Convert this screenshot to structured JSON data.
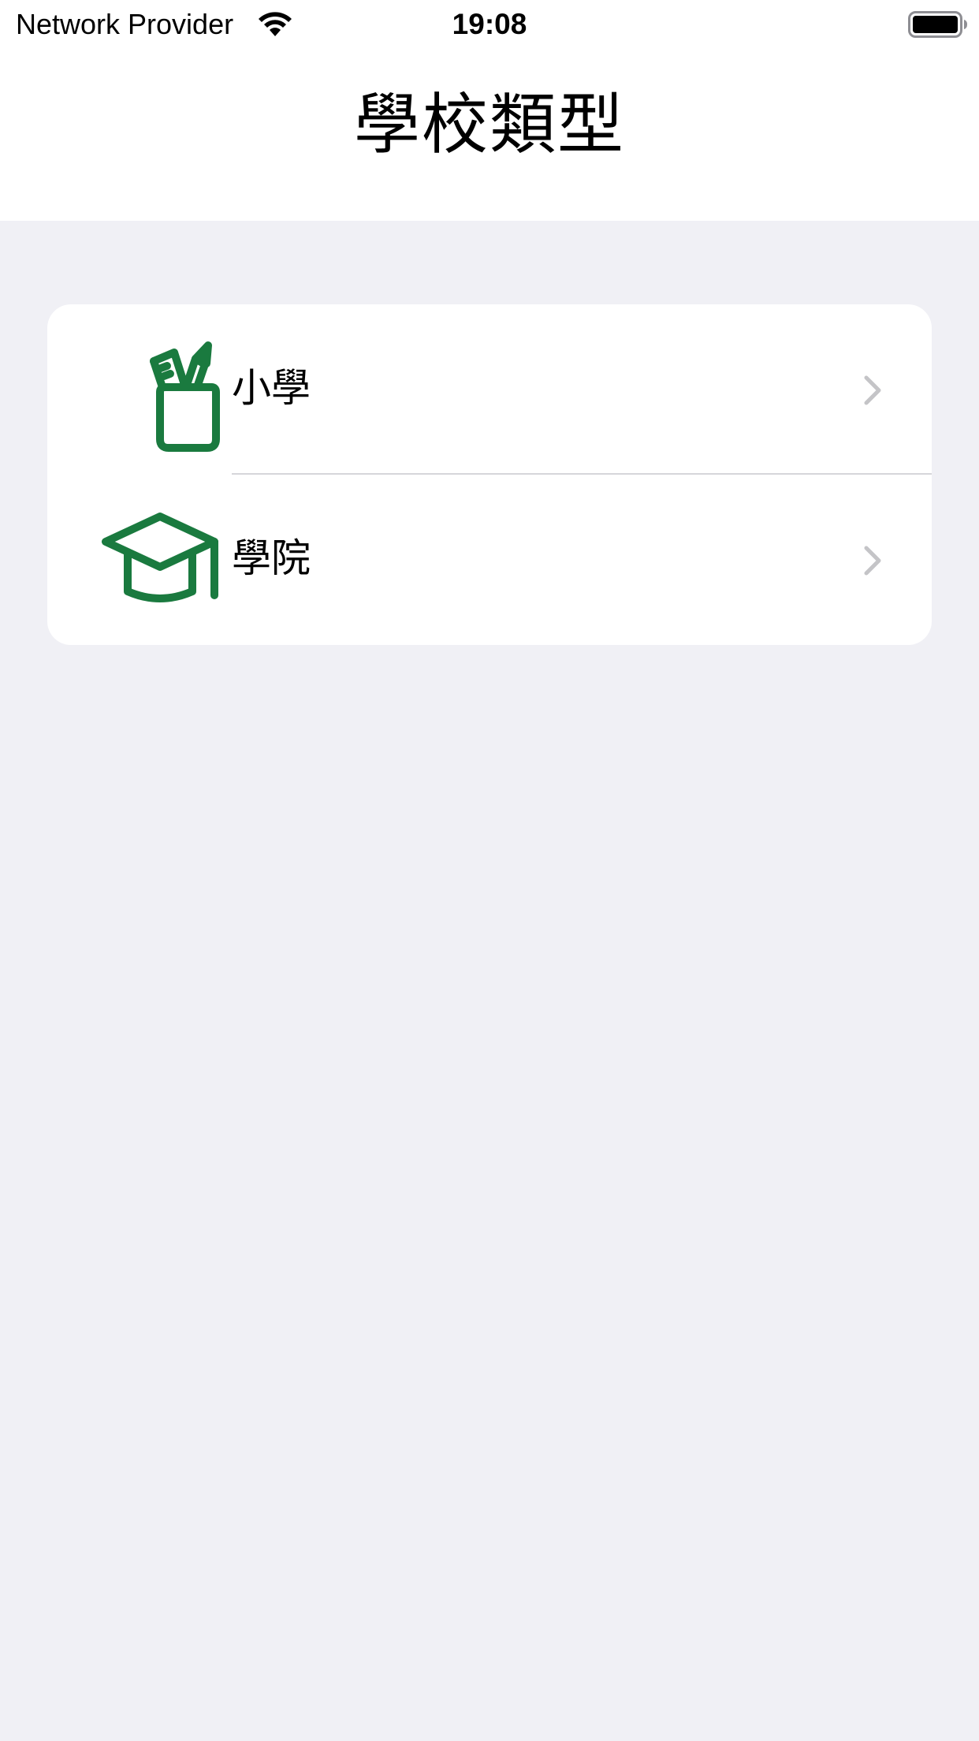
{
  "status_bar": {
    "carrier": "Network Provider",
    "time": "19:08",
    "wifi_icon": "wifi-icon",
    "battery_icon": "battery-full-icon"
  },
  "nav": {
    "title": "學校類型"
  },
  "list": {
    "items": [
      {
        "label": "小學",
        "icon": "pencil-cup-icon"
      },
      {
        "label": "學院",
        "icon": "graduation-cap-icon"
      }
    ],
    "chevron_icon": "chevron-right-icon"
  },
  "colors": {
    "accent": "#1a7a3f",
    "background": "#f0f0f5",
    "chevron": "#c4c4c7"
  }
}
